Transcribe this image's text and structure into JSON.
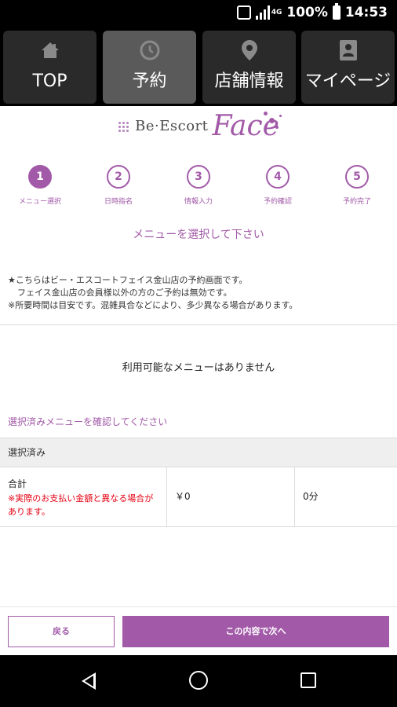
{
  "status_bar": {
    "network": "4G",
    "battery": "100%",
    "time": "14:53"
  },
  "nav": {
    "tabs": [
      {
        "label": "TOP",
        "icon": "home-icon"
      },
      {
        "label": "予約",
        "icon": "clock-icon"
      },
      {
        "label": "店舗情報",
        "icon": "map-pin-icon"
      },
      {
        "label": "マイページ",
        "icon": "profile-icon"
      }
    ],
    "active_index": 1
  },
  "logo": {
    "brand": "Be·Escort",
    "name": "Face"
  },
  "steps": [
    {
      "number": "1",
      "label": "メニュー選択"
    },
    {
      "number": "2",
      "label": "日時指名"
    },
    {
      "number": "3",
      "label": "情報入力"
    },
    {
      "number": "4",
      "label": "予約確認"
    },
    {
      "number": "5",
      "label": "予約完了"
    }
  ],
  "instruction": "メニューを選択して下さい",
  "notice": {
    "line1": "★こちらはビー・エスコートフェイス金山店の予約画面です。",
    "line2": "フェイス金山店の会員様以外の方のご予約は無効です。",
    "line3": "※所要時間は目安です。混雑具合などにより、多少異なる場合があります。"
  },
  "no_menu_message": "利用可能なメニューはありません",
  "confirm_link": "選択済みメニューを確認してください",
  "selected": {
    "header": "選択済み",
    "total_label": "合計",
    "warning": "※実際のお支払い金額と異なる場合があります。",
    "amount": "￥0",
    "duration": "0分"
  },
  "buttons": {
    "back": "戻る",
    "next": "この内容で次へ"
  },
  "colors": {
    "accent": "#a25aa8",
    "warning": "#e60012"
  }
}
